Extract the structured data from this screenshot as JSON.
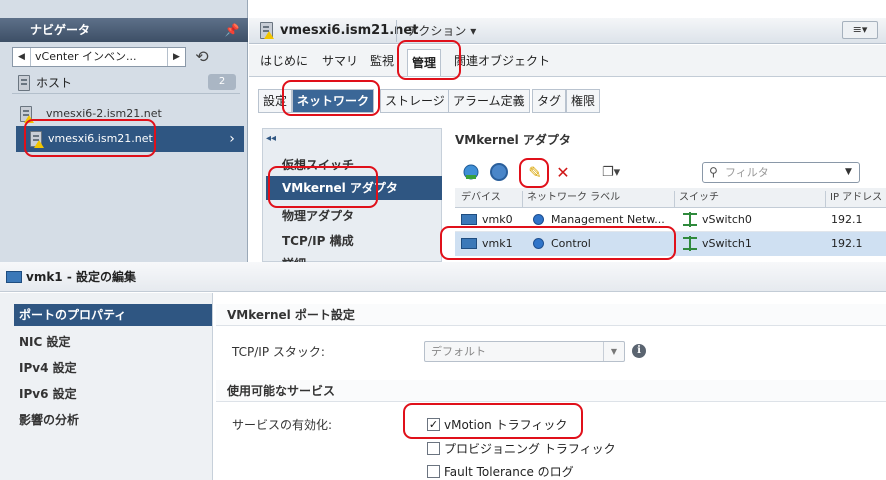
{
  "navigator": {
    "title": "ナビゲータ",
    "breadcrumb": "vCenter インベン...",
    "hosts_label": "ホスト",
    "hosts_count": "2",
    "items": [
      {
        "label": "vmesxi6-2.ism21.net",
        "selected": false
      },
      {
        "label": "vmesxi6.ism21.net",
        "selected": true
      }
    ]
  },
  "host": {
    "title": "vmesxi6.ism21.net",
    "actions": "アクション ▾"
  },
  "main_tabs": [
    "はじめに",
    "サマリ",
    "監視",
    "管理",
    "関連オブジェクト"
  ],
  "sub_tabs": [
    "設定",
    "ネットワーク",
    "ストレージ",
    "アラーム定義",
    "タグ",
    "権限"
  ],
  "subnav": {
    "items": [
      "仮想スイッチ",
      "VMkernel アダプタ",
      "物理アダプタ",
      "TCP/IP 構成",
      "詳細"
    ]
  },
  "vmk_panel": {
    "title": "VMkernel アダプタ",
    "filter_placeholder": "フィルタ",
    "columns": [
      "デバイス",
      "ネットワーク ラベル",
      "スイッチ",
      "IP アドレス"
    ],
    "rows": [
      {
        "device": "vmk0",
        "label": "Management Netw...",
        "switch": "vSwitch0",
        "ip": "192.1"
      },
      {
        "device": "vmk1",
        "label": "Control",
        "switch": "vSwitch1",
        "ip": "192.1"
      }
    ]
  },
  "dialog": {
    "title": "vmk1 - 設定の編集",
    "nav": [
      "ポートのプロパティ",
      "NIC 設定",
      "IPv4 設定",
      "IPv6 設定",
      "影響の分析"
    ],
    "section1": "VMkernel ポート設定",
    "tcp_label": "TCP/IP スタック:",
    "tcp_value": "デフォルト",
    "section2": "使用可能なサービス",
    "services_label": "サービスの有効化:",
    "services": [
      {
        "label": "vMotion トラフィック",
        "checked": true
      },
      {
        "label": "プロビジョニング トラフィック",
        "checked": false
      },
      {
        "label": "Fault Tolerance のログ",
        "checked": false
      }
    ]
  },
  "colors": {
    "accent": "#2f5682",
    "highlight": "#e0101a",
    "selected_row": "#cfe0f2"
  }
}
